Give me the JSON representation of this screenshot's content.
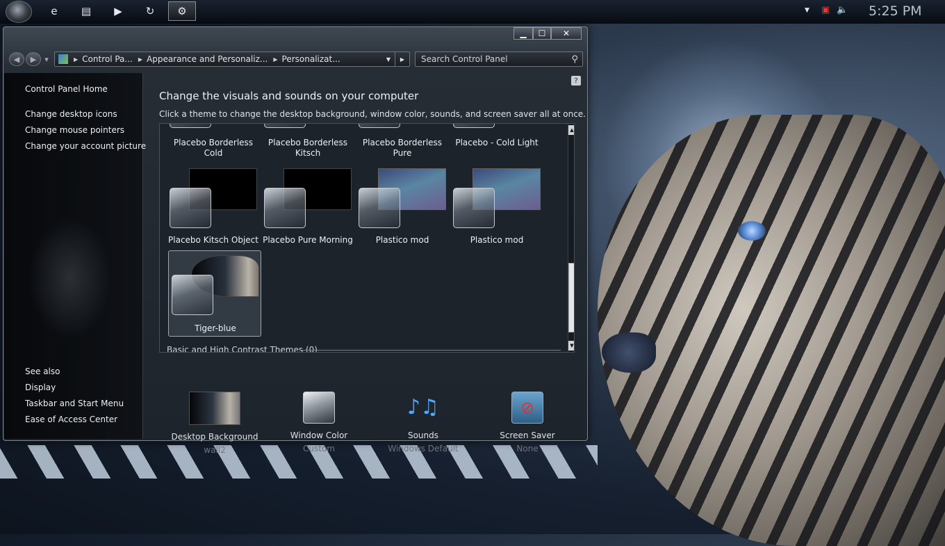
{
  "taskbar": {
    "start_icon": "dragon-orb-icon",
    "buttons": [
      {
        "icon": "internet-explorer-icon",
        "glyph": "e"
      },
      {
        "icon": "folder-icon",
        "glyph": "▤"
      },
      {
        "icon": "media-play-icon",
        "glyph": "▶"
      },
      {
        "icon": "refresh-icon",
        "glyph": "↻"
      },
      {
        "icon": "gear-icon",
        "glyph": "⚙"
      }
    ],
    "tray": {
      "expand_glyph": "▼",
      "network_glyph": "▣",
      "volume_glyph": "🔈"
    },
    "clock": "5:25 PM"
  },
  "window": {
    "controls": {
      "minimize": "▁",
      "maximize": "☐",
      "close": "✕"
    },
    "address": {
      "crumbs": [
        "Control Pa...",
        "Appearance and Personaliz...",
        "Personalizat..."
      ],
      "separator": "▶",
      "dropdown": "▼"
    },
    "search": {
      "placeholder": "Search Control Panel",
      "icon": "search-icon"
    },
    "help_glyph": "?"
  },
  "leftnav": {
    "home": "Control Panel Home",
    "links": [
      "Change desktop icons",
      "Change mouse pointers",
      "Change your account picture"
    ],
    "see_also_heading": "See also",
    "see_also": [
      "Display",
      "Taskbar and Start Menu",
      "Ease of Access Center"
    ]
  },
  "main": {
    "title": "Change the visuals and sounds on your computer",
    "description": "Click a theme to change the desktop background, window color, sounds, and screen saver all at once.",
    "themes_row1": [
      "Placebo Borderless Cold",
      "Placebo Borderless Kitsch",
      "Placebo Borderless Pure",
      "Placebo - Cold Light"
    ],
    "themes_row2": [
      "Placebo Kitsch Object",
      "Placebo Pure Morning",
      "Plastico mod",
      "Plastico mod"
    ],
    "themes_row3": [
      "Tiger-blue"
    ],
    "section_basic": "Basic and High Contrast Themes (0)"
  },
  "quick_settings": [
    {
      "label": "Desktop Background",
      "value": "wall2",
      "icon": "desktop-background-icon"
    },
    {
      "label": "Window Color",
      "value": "Custom",
      "icon": "window-color-icon"
    },
    {
      "label": "Sounds",
      "value": "Windows Default",
      "icon": "sounds-icon",
      "glyph": "♪♫"
    },
    {
      "label": "Screen Saver",
      "value": "None",
      "icon": "screen-saver-icon",
      "glyph": "⊘"
    }
  ]
}
